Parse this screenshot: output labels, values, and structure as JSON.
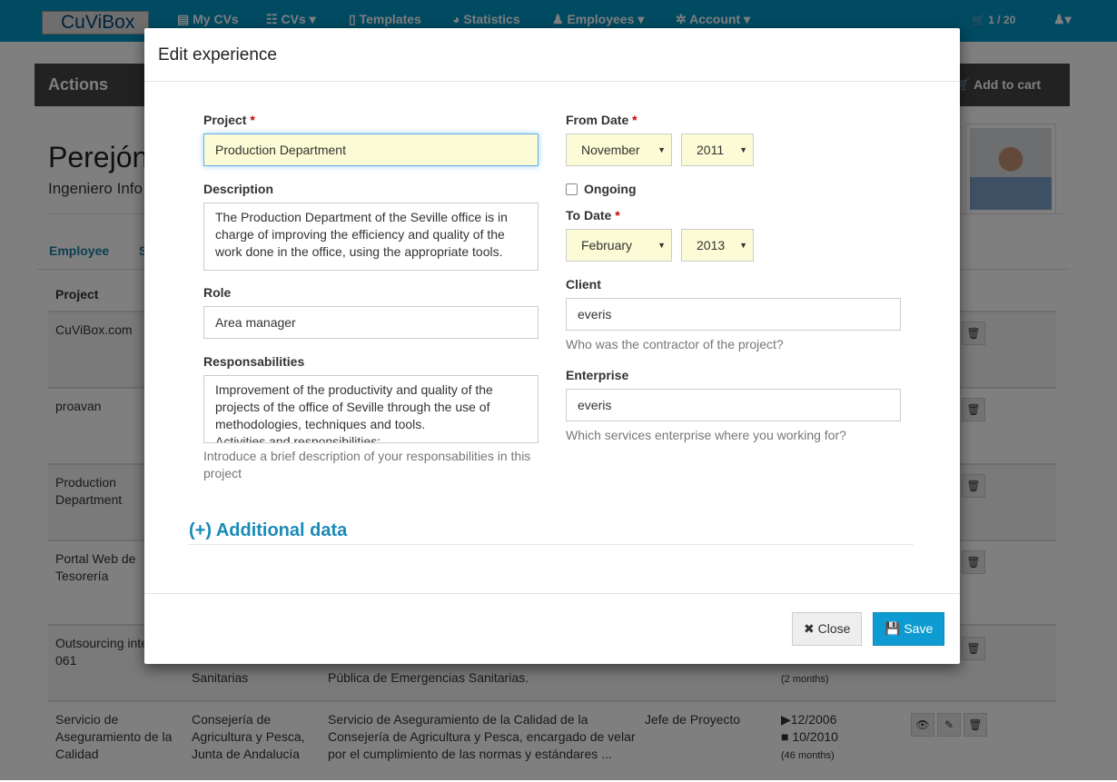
{
  "nav": {
    "logo": "CuViBox",
    "items": [
      "My CVs",
      "CVs ▾",
      "Templates",
      "Statistics",
      "Employees ▾",
      "Account ▾"
    ],
    "cart": "1 / 20",
    "user_menu": "▾"
  },
  "actions": {
    "title": "Actions",
    "add_to_cart": "Add to cart"
  },
  "profile": {
    "name": "Perejón",
    "subtitle": "Ingeniero Info",
    "tabs": [
      "Employee",
      "S"
    ]
  },
  "table": {
    "header": "Project",
    "rows": [
      {
        "project": "CuViBox.com"
      },
      {
        "project": "proavan"
      },
      {
        "project": "Production Department"
      },
      {
        "project": "Portal Web de Tesorería"
      },
      {
        "project": "Outsourcing inte 061",
        "client": "Sanitarias",
        "desc": "Pública de Emergencias Sanitarias.",
        "dur": "(2 months)"
      },
      {
        "project": "Servicio de Aseguramiento de la Calidad",
        "client": "Consejería de Agricultura y Pesca, Junta de Andalucía",
        "desc": "Servicio de Aseguramiento de la Calidad de la Consejería de Agricultura y Pesca, encargado de velar por el cumplimiento de las normas y estándares ...",
        "role": "Jefe de Proyecto",
        "from": "▶12/2006",
        "to": "■ 10/2010",
        "dur": "(46 months)"
      }
    ]
  },
  "modal": {
    "title": "Edit experience",
    "project": {
      "label": "Project",
      "value": "Production Department"
    },
    "description": {
      "label": "Description",
      "value": "The Production Department of the Seville office is in charge of improving the efficiency and quality of the work done in the office, using the appropriate tools."
    },
    "role": {
      "label": "Role",
      "value": "Area manager"
    },
    "responsabilities": {
      "label": "Responsabilities",
      "value": "Improvement of the productivity and quality of the projects of the office of Seville through the use of methodologies, techniques and tools.\nActivities and responsibilities:",
      "help": "Introduce a brief description of your responsabilities in this project"
    },
    "from_date": {
      "label": "From Date",
      "month": "November",
      "year": "2011"
    },
    "ongoing": {
      "label": "Ongoing",
      "checked": false
    },
    "to_date": {
      "label": "To Date",
      "month": "February",
      "year": "2013"
    },
    "client": {
      "label": "Client",
      "value": "everis",
      "help": "Who was the contractor of the project?"
    },
    "enterprise": {
      "label": "Enterprise",
      "value": "everis",
      "help": "Which services enterprise where you working for?"
    },
    "additional": "(+) Additional data",
    "close": "Close",
    "save": "Save",
    "required_mark": "*"
  },
  "colors": {
    "navbar": "#0094c4",
    "accent": "#1a8ab8",
    "save": "#0e9bd1",
    "field_highlight": "#fbfbd5"
  }
}
